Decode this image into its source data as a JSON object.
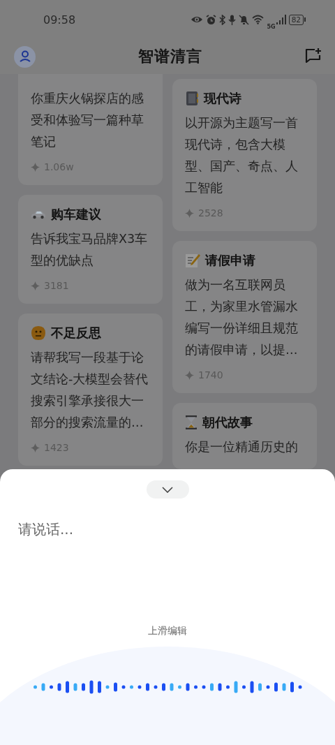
{
  "status_bar": {
    "time": "09:58",
    "network": "5G",
    "battery": "82"
  },
  "header": {
    "title": "智谱清言"
  },
  "columns": [
    {
      "cards": [
        {
          "text": "你重庆火锅探店的感受和体验写一篇种草笔记",
          "count": "1.06w"
        },
        {
          "title": "购车建议",
          "text": "告诉我宝马品牌X3车型的优缺点",
          "count": "3181"
        },
        {
          "title": "不足反思",
          "text": "请帮我写一段基于论文结论-大模型会替代搜索引擎承接很大一部分的搜索流量的…",
          "count": "1423"
        }
      ]
    },
    {
      "cards": [
        {
          "title": "现代诗",
          "text": "以开源为主题写一首现代诗，包含大模型、国产、奇点、人工智能",
          "count": "2528"
        },
        {
          "title": "请假申请",
          "text": "做为一名互联网员工，为家里水管漏水编写一份详细且规范的请假申请，以提…",
          "count": "1740"
        },
        {
          "title": "朝代故事",
          "text": "你是一位精通历史的"
        }
      ]
    }
  ],
  "voice_sheet": {
    "prompt": "请说话...",
    "hint": "上滑编辑"
  }
}
